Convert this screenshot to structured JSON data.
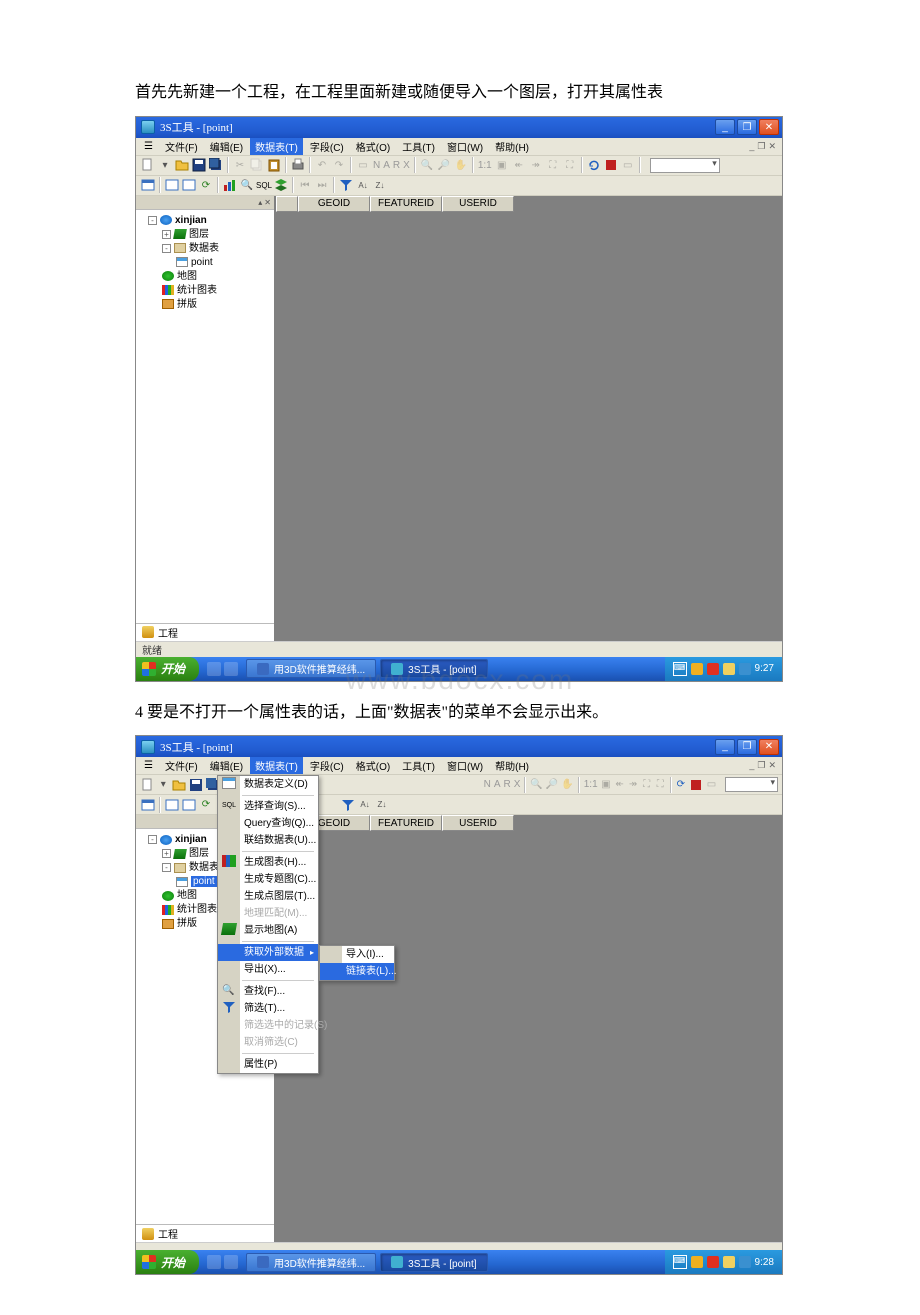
{
  "caption1": "首先先新建一个工程，在工程里面新建或随便导入一个图层，打开其属性表",
  "caption2": "4 要是不打开一个属性表的话，上面\"数据表\"的菜单不会显示出来。",
  "watermark": "www.bdocx.com",
  "shots": {
    "title": "3S工具 - [point]",
    "winBtns": {
      "min": "_",
      "max": "❐",
      "close": "✕"
    },
    "childBtns": [
      "_",
      "❐",
      "✕"
    ],
    "menu": {
      "iconLead": "☰",
      "items": [
        "文件(F)",
        "编辑(E)",
        "数据表(T)",
        "字段(C)",
        "格式(O)",
        "工具(T)",
        "窗口(W)",
        "帮助(H)"
      ],
      "hotIndex": 2
    },
    "toolbar1_text": [
      "N",
      "A",
      "R",
      "X"
    ],
    "headers": [
      "GEOID",
      "FEATUREID",
      "USERID"
    ],
    "tree": {
      "root": "xinjian",
      "layers": "图层",
      "tables": "数据表",
      "point": "point",
      "map": "地图",
      "charts": "统计图表",
      "tiles": "拼版"
    },
    "sidebarTab": "工程",
    "status": "就绪",
    "taskbar": {
      "start": "开始",
      "task1": "用3D软件推算经纬...",
      "task2": "3S工具 - [point]",
      "time1": "9:27",
      "time2": "9:28"
    }
  },
  "menu2": {
    "items": [
      {
        "label": "数据表定义(D)",
        "icon": "table"
      },
      {
        "sep": true
      },
      {
        "label": "选择查询(S)...",
        "icon": "sql"
      },
      {
        "label": "Query查询(Q)..."
      },
      {
        "label": "联结数据表(U)..."
      },
      {
        "sep": true
      },
      {
        "label": "生成图表(H)...",
        "icon": "chart"
      },
      {
        "label": "生成专题图(C)..."
      },
      {
        "label": "生成点图层(T)..."
      },
      {
        "label": "地理匹配(M)...",
        "dis": true
      },
      {
        "label": "显示地图(A)",
        "icon": "layers"
      },
      {
        "sep": true
      },
      {
        "label": "获取外部数据",
        "sel": true,
        "arrow": true
      },
      {
        "label": "导出(X)..."
      },
      {
        "sep": true
      },
      {
        "label": "查找(F)...",
        "icon": "find"
      },
      {
        "label": "筛选(T)...",
        "icon": "filter"
      },
      {
        "label": "筛选选中的记录(S)",
        "dis": true
      },
      {
        "label": "取消筛选(C)",
        "dis": true
      },
      {
        "sep": true
      },
      {
        "label": "属性(P)"
      }
    ],
    "submenu": [
      {
        "label": "导入(I)..."
      },
      {
        "label": "链接表(L)...",
        "sel": true
      }
    ]
  }
}
